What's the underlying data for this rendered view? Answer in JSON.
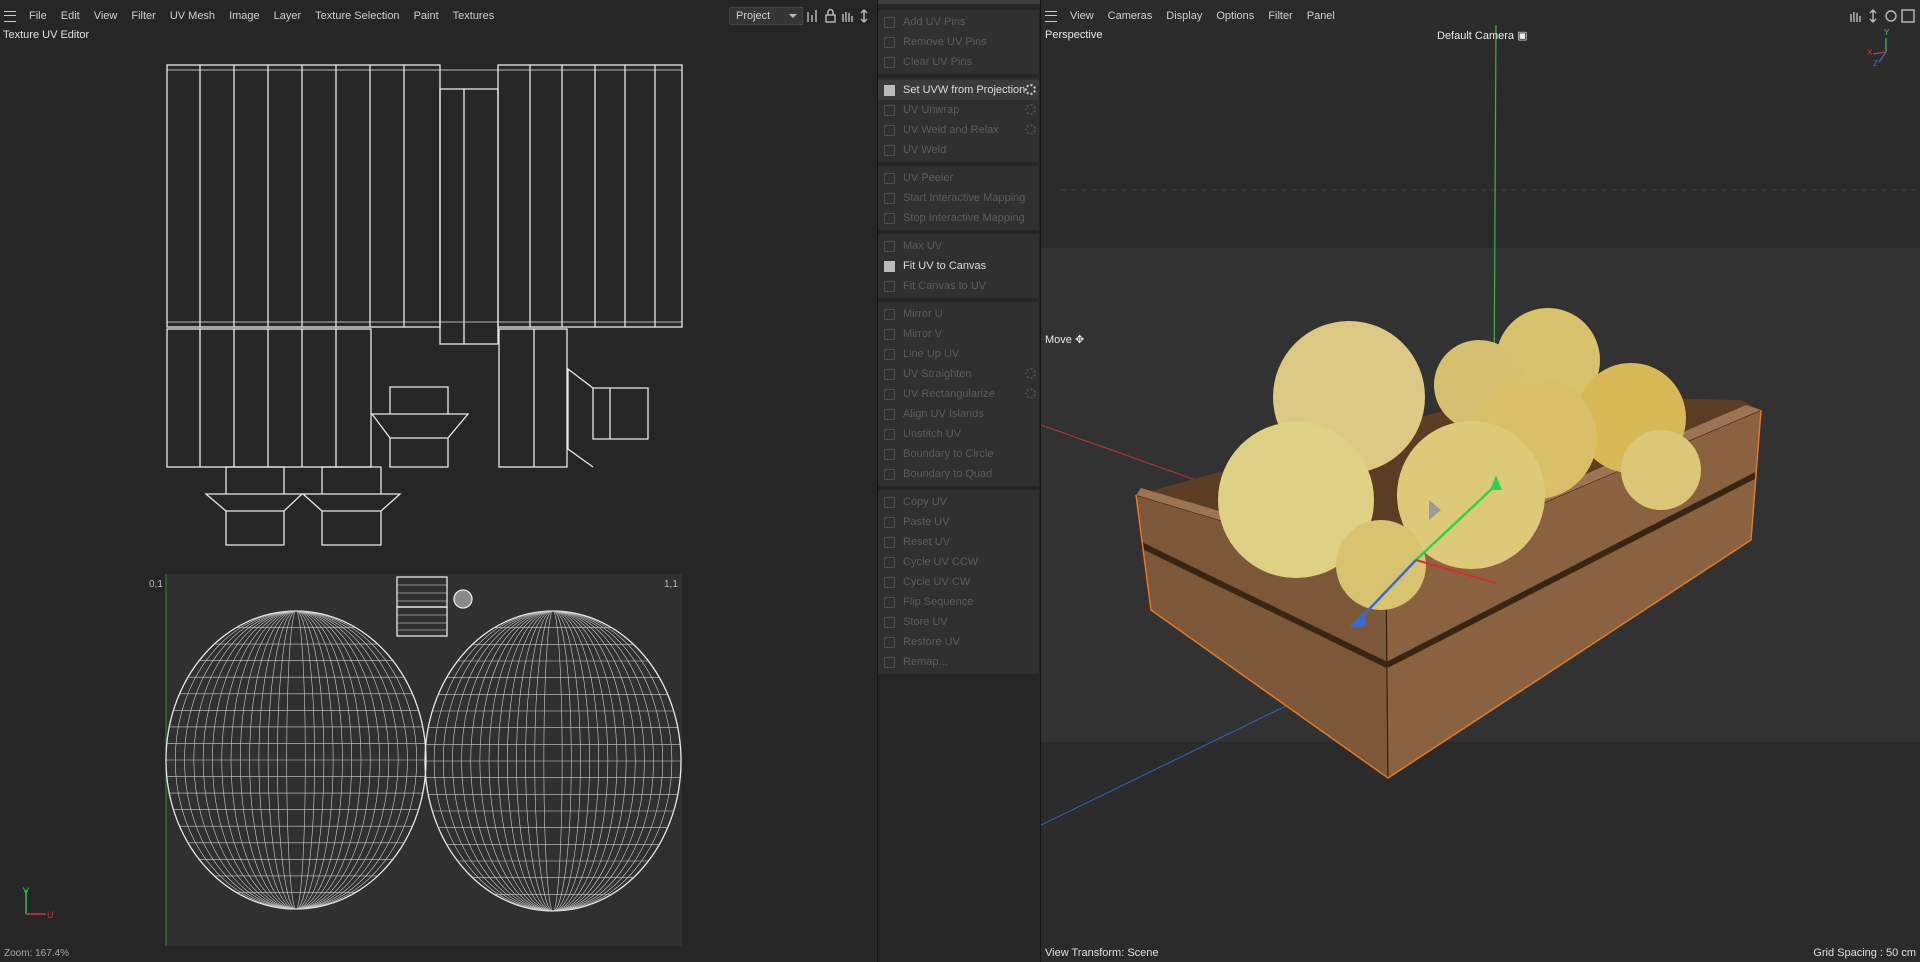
{
  "uv_menu": [
    "File",
    "Edit",
    "View",
    "Filter",
    "UV Mesh",
    "Image",
    "Layer",
    "Texture Selection",
    "Paint",
    "Textures"
  ],
  "project_dropdown": "Project",
  "uv_editor_title": "Texture UV Editor",
  "uv_corner_left": "0,1",
  "uv_corner_right": "1,1",
  "axis_v": "V",
  "axis_u": "U",
  "zoom_status": "Zoom: 167.4%",
  "commands": [
    [
      {
        "label": "Add UV Pins",
        "active": false
      },
      {
        "label": "Remove UV Pins",
        "active": false
      },
      {
        "label": "Clear UV Pins",
        "active": false
      }
    ],
    [
      {
        "label": "Set UVW from Projection",
        "active": true,
        "gear": true,
        "hl": true
      },
      {
        "label": "UV Unwrap",
        "active": false,
        "gear": true
      },
      {
        "label": "UV Weld and Relax",
        "active": false,
        "gear": true
      },
      {
        "label": "UV Weld",
        "active": false
      }
    ],
    [
      {
        "label": "UV Peeler",
        "active": false
      },
      {
        "label": "Start Interactive Mapping",
        "active": false
      },
      {
        "label": "Stop Interactive Mapping",
        "active": false
      }
    ],
    [
      {
        "label": "Max UV",
        "active": false
      },
      {
        "label": "Fit UV to Canvas",
        "active": true
      },
      {
        "label": "Fit Canvas to UV",
        "active": false
      }
    ],
    [
      {
        "label": "Mirror U",
        "active": false
      },
      {
        "label": "Mirror V",
        "active": false
      },
      {
        "label": "Line Up UV",
        "active": false
      },
      {
        "label": "UV Straighten",
        "active": false,
        "gear": true
      },
      {
        "label": "UV Rectangularize",
        "active": false,
        "gear": true
      },
      {
        "label": "Align UV Islands",
        "active": false
      },
      {
        "label": "Unstitch UV",
        "active": false
      },
      {
        "label": "Boundary to Circle",
        "active": false
      },
      {
        "label": "Boundary to Quad",
        "active": false
      }
    ],
    [
      {
        "label": "Copy UV",
        "active": false
      },
      {
        "label": "Paste UV",
        "active": false
      },
      {
        "label": "Reset UV",
        "active": false
      },
      {
        "label": "Cycle UV CCW",
        "active": false
      },
      {
        "label": "Cycle UV CW",
        "active": false
      },
      {
        "label": "Flip Sequence",
        "active": false
      },
      {
        "label": "Store UV",
        "active": false
      },
      {
        "label": "Restore UV",
        "active": false
      },
      {
        "label": "Remap...",
        "active": false
      }
    ]
  ],
  "vp_menu": [
    "View",
    "Cameras",
    "Display",
    "Options",
    "Filter",
    "Panel"
  ],
  "vp_perspective": "Perspective",
  "vp_camera": "Default Camera",
  "vp_move": "Move",
  "vp_view_transform": "View Transform: Scene",
  "vp_grid_spacing": "Grid Spacing : 50 cm",
  "gizmo_labels": {
    "x": "X",
    "y": "Y",
    "z": "Z"
  },
  "colors": {
    "bg": "#262626",
    "panel": "#303030",
    "wire": "#e6e6e6",
    "x_axis": "#c83a3a",
    "y_axis": "#3ac85a",
    "z_axis": "#3a6ac8",
    "wood": "#7a5532",
    "melon": "#e0c97a",
    "selection": "#e07a2a"
  }
}
